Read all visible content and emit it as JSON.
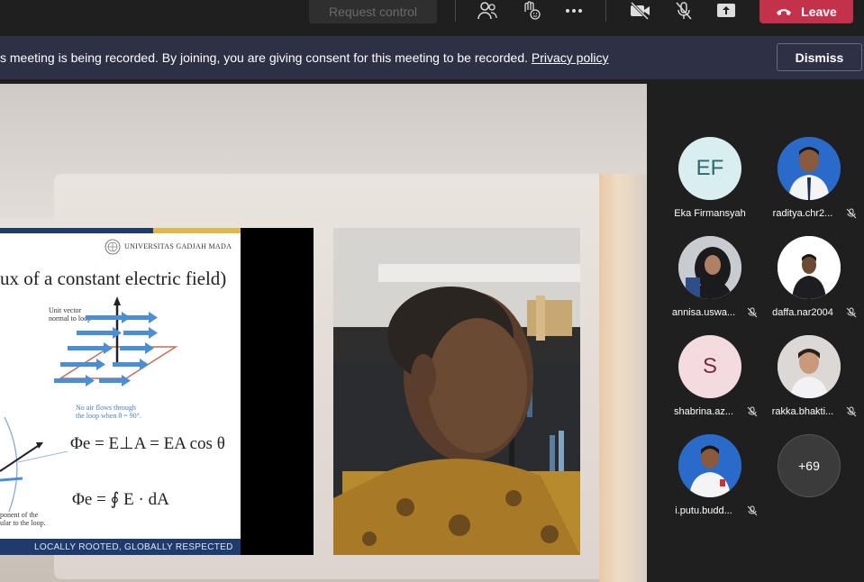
{
  "toolbar": {
    "request_control_label": "Request control",
    "leave_label": "Leave",
    "icons": [
      "people-icon",
      "raise-hand-icon",
      "more-icon",
      "camera-off-icon",
      "mic-off-icon",
      "share-icon"
    ]
  },
  "banner": {
    "text": "s meeting is being recorded. By joining, you are giving consent for this meeting to be recorded. ",
    "link": "Privacy policy",
    "dismiss_label": "Dismiss"
  },
  "slide": {
    "university": "UNIVERSITAS GADJAH MADA",
    "title": "ux of a constant electric field)",
    "unit_vector_label_1": "Unit vector",
    "unit_vector_label_2": "normal to loop",
    "no_air_1": "No air flows through",
    "no_air_2": "the loop when θ = 90°.",
    "equation_1": "Φe = E⊥A = EA cos θ",
    "equation_2": "Φe = ∮ E · dA",
    "component_1": "ponent of the",
    "component_2": "ular to the loop.",
    "footer": "LOCALLY ROOTED, GLOBALLY RESPECTED"
  },
  "participants": [
    {
      "name": "Eka Firmansyah",
      "initials": "EF",
      "muted": false,
      "avatar_bg": "#d9eeee",
      "avatar_fg": "#2b6b70"
    },
    {
      "name": "raditya.chr2...",
      "initials": "",
      "muted": true,
      "avatar_bg": "#2a6bc9"
    },
    {
      "name": "annisa.uswa...",
      "initials": "",
      "muted": true,
      "avatar_bg": "#bfc5cc"
    },
    {
      "name": "daffa.nar2004",
      "initials": "",
      "muted": true,
      "avatar_bg": "#ffffff"
    },
    {
      "name": "shabrina.az...",
      "initials": "S",
      "muted": true,
      "avatar_bg": "#f3dbe0",
      "avatar_fg": "#7a2a3a"
    },
    {
      "name": "rakka.bhakti...",
      "initials": "",
      "muted": true,
      "avatar_bg": "#d9d5d2"
    },
    {
      "name": "i.putu.budd...",
      "initials": "",
      "muted": true,
      "avatar_bg": "#2a6bc9"
    }
  ],
  "more_participants": "+69",
  "colors": {
    "leave": "#c4314b",
    "banner": "#2e3045",
    "background": "#1f1f1f",
    "slide_navy": "#1f3b6e",
    "slide_gold": "#e0b84a"
  }
}
